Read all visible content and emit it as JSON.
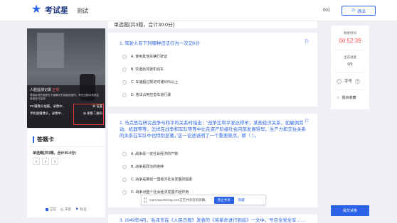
{
  "header": {
    "brand": "考试星",
    "tab": "测试",
    "user_id": "001",
    "logout_label": "退出"
  },
  "monitor": {
    "title": "人脸监测记录",
    "status": "正常",
    "desc": "请保持您的面部处于摄像头的拍摄范围内，考试过程中系统会持续进行监测",
    "pc_label": "PC摄像头拍摄，录像中...",
    "settings_label": "设置",
    "mobile_label": "手机副摄像头，录像中...",
    "qr_label": "查看二维码"
  },
  "answer_card": {
    "title": "答题卡",
    "section": "单选题(共3题，合计30.0分)",
    "numbers": [
      "1",
      "2",
      "3"
    ],
    "legend": {
      "answered": "已答",
      "unanswered": "未答",
      "flagged": "标记"
    }
  },
  "main": {
    "section_title": "单选题(共3题，合计30.0分)",
    "questions": [
      {
        "title": "1. 驾驶人有下列哪种违法行为一次记6分",
        "options": [
          "A. 使用其他车辆行驶证",
          "B. 饮酒后驾驶机动车",
          "C. 车速超过规定时速50%以上",
          "D. 违法占用应急车道行驶"
        ]
      },
      {
        "title": "2. 马克思在研究战争与和平的关系时指出：“战争比和平发达得早；某些经济关系，如雇佣劳动、机器等等，怎样在战争和军队等等中比在资产阶级社会内部发展得早。生产力和交往关系的关系在军队中也特别显著。”这一论述说明了一个重要观点，即（  ）。",
        "options": [
          "A. 战争是一定社会经济的产物",
          "B. 战争是政治的继续",
          "C. 战争是推动一国经济社会发展的因素",
          "D. 战争对整个社会经济发展不起作用"
        ]
      },
      {
        "title": "3. 1949年4月，毛泽东在《人民日报》发表的《将革命进行到底》一文中，号召全党全军……"
      }
    ]
  },
  "toast": {
    "text": "mam.kaoshixing.com正在共享您的屏幕。",
    "stop_label": "停止共享",
    "hide_label": "隐藏"
  },
  "sidebar": {
    "time_label": "剩余时间",
    "time_value": "00:52:39",
    "progress_label": "当前进度",
    "progress_value": "0/3",
    "font_label": "字号",
    "collect_label": "题目收藏",
    "submit_label": "提交试卷"
  }
}
